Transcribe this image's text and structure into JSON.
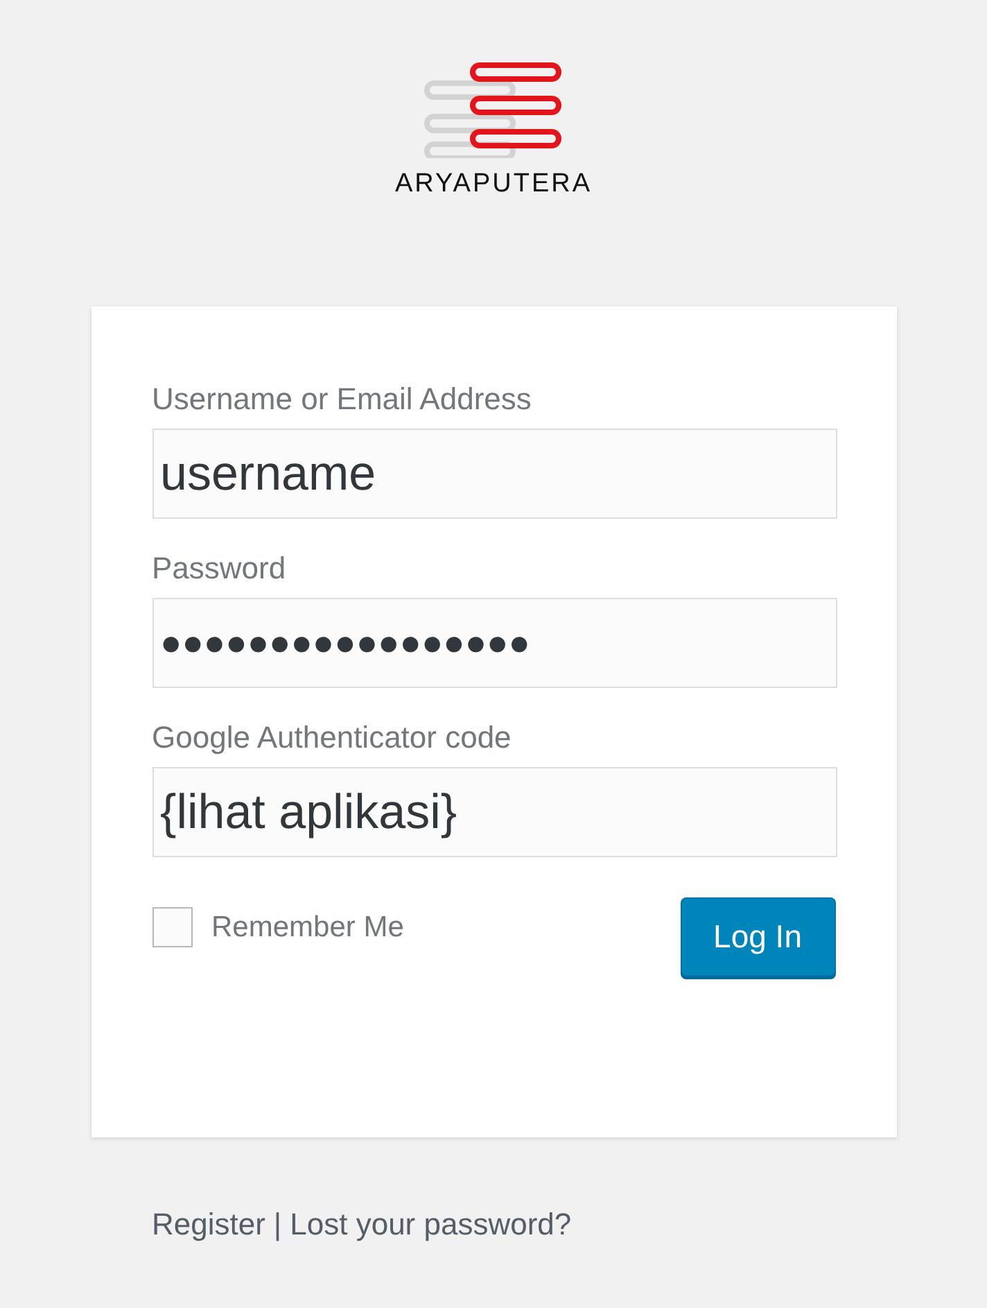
{
  "logo": {
    "text": "ARYAPUTERA"
  },
  "fields": [
    {
      "label": "Username or Email Address",
      "value": "username"
    },
    {
      "label": "Password",
      "value": "●●●●●●●●●●●●●●●●●"
    },
    {
      "label": "Google Authenticator code",
      "value": "{lihat aplikasi}"
    }
  ],
  "remember": {
    "label": "Remember Me",
    "checked": false
  },
  "submit": {
    "label": "Log In"
  },
  "links": [
    {
      "label": "Register"
    },
    {
      "label": "Lost your password?"
    }
  ],
  "separator": "|"
}
